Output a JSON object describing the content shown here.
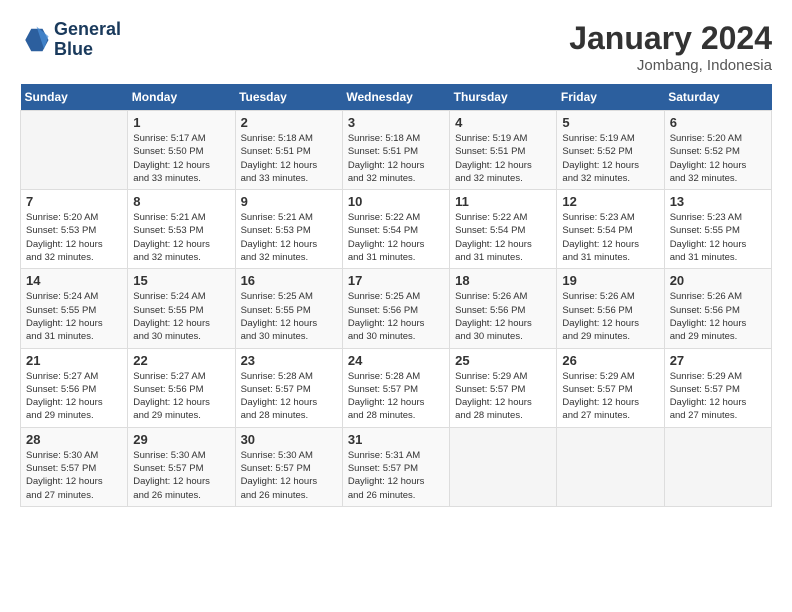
{
  "header": {
    "logo_line1": "General",
    "logo_line2": "Blue",
    "month_title": "January 2024",
    "location": "Jombang, Indonesia"
  },
  "days_of_week": [
    "Sunday",
    "Monday",
    "Tuesday",
    "Wednesday",
    "Thursday",
    "Friday",
    "Saturday"
  ],
  "weeks": [
    [
      {
        "day": "",
        "info": ""
      },
      {
        "day": "1",
        "info": "Sunrise: 5:17 AM\nSunset: 5:50 PM\nDaylight: 12 hours\nand 33 minutes."
      },
      {
        "day": "2",
        "info": "Sunrise: 5:18 AM\nSunset: 5:51 PM\nDaylight: 12 hours\nand 33 minutes."
      },
      {
        "day": "3",
        "info": "Sunrise: 5:18 AM\nSunset: 5:51 PM\nDaylight: 12 hours\nand 32 minutes."
      },
      {
        "day": "4",
        "info": "Sunrise: 5:19 AM\nSunset: 5:51 PM\nDaylight: 12 hours\nand 32 minutes."
      },
      {
        "day": "5",
        "info": "Sunrise: 5:19 AM\nSunset: 5:52 PM\nDaylight: 12 hours\nand 32 minutes."
      },
      {
        "day": "6",
        "info": "Sunrise: 5:20 AM\nSunset: 5:52 PM\nDaylight: 12 hours\nand 32 minutes."
      }
    ],
    [
      {
        "day": "7",
        "info": "Sunrise: 5:20 AM\nSunset: 5:53 PM\nDaylight: 12 hours\nand 32 minutes."
      },
      {
        "day": "8",
        "info": "Sunrise: 5:21 AM\nSunset: 5:53 PM\nDaylight: 12 hours\nand 32 minutes."
      },
      {
        "day": "9",
        "info": "Sunrise: 5:21 AM\nSunset: 5:53 PM\nDaylight: 12 hours\nand 32 minutes."
      },
      {
        "day": "10",
        "info": "Sunrise: 5:22 AM\nSunset: 5:54 PM\nDaylight: 12 hours\nand 31 minutes."
      },
      {
        "day": "11",
        "info": "Sunrise: 5:22 AM\nSunset: 5:54 PM\nDaylight: 12 hours\nand 31 minutes."
      },
      {
        "day": "12",
        "info": "Sunrise: 5:23 AM\nSunset: 5:54 PM\nDaylight: 12 hours\nand 31 minutes."
      },
      {
        "day": "13",
        "info": "Sunrise: 5:23 AM\nSunset: 5:55 PM\nDaylight: 12 hours\nand 31 minutes."
      }
    ],
    [
      {
        "day": "14",
        "info": "Sunrise: 5:24 AM\nSunset: 5:55 PM\nDaylight: 12 hours\nand 31 minutes."
      },
      {
        "day": "15",
        "info": "Sunrise: 5:24 AM\nSunset: 5:55 PM\nDaylight: 12 hours\nand 30 minutes."
      },
      {
        "day": "16",
        "info": "Sunrise: 5:25 AM\nSunset: 5:55 PM\nDaylight: 12 hours\nand 30 minutes."
      },
      {
        "day": "17",
        "info": "Sunrise: 5:25 AM\nSunset: 5:56 PM\nDaylight: 12 hours\nand 30 minutes."
      },
      {
        "day": "18",
        "info": "Sunrise: 5:26 AM\nSunset: 5:56 PM\nDaylight: 12 hours\nand 30 minutes."
      },
      {
        "day": "19",
        "info": "Sunrise: 5:26 AM\nSunset: 5:56 PM\nDaylight: 12 hours\nand 29 minutes."
      },
      {
        "day": "20",
        "info": "Sunrise: 5:26 AM\nSunset: 5:56 PM\nDaylight: 12 hours\nand 29 minutes."
      }
    ],
    [
      {
        "day": "21",
        "info": "Sunrise: 5:27 AM\nSunset: 5:56 PM\nDaylight: 12 hours\nand 29 minutes."
      },
      {
        "day": "22",
        "info": "Sunrise: 5:27 AM\nSunset: 5:56 PM\nDaylight: 12 hours\nand 29 minutes."
      },
      {
        "day": "23",
        "info": "Sunrise: 5:28 AM\nSunset: 5:57 PM\nDaylight: 12 hours\nand 28 minutes."
      },
      {
        "day": "24",
        "info": "Sunrise: 5:28 AM\nSunset: 5:57 PM\nDaylight: 12 hours\nand 28 minutes."
      },
      {
        "day": "25",
        "info": "Sunrise: 5:29 AM\nSunset: 5:57 PM\nDaylight: 12 hours\nand 28 minutes."
      },
      {
        "day": "26",
        "info": "Sunrise: 5:29 AM\nSunset: 5:57 PM\nDaylight: 12 hours\nand 27 minutes."
      },
      {
        "day": "27",
        "info": "Sunrise: 5:29 AM\nSunset: 5:57 PM\nDaylight: 12 hours\nand 27 minutes."
      }
    ],
    [
      {
        "day": "28",
        "info": "Sunrise: 5:30 AM\nSunset: 5:57 PM\nDaylight: 12 hours\nand 27 minutes."
      },
      {
        "day": "29",
        "info": "Sunrise: 5:30 AM\nSunset: 5:57 PM\nDaylight: 12 hours\nand 26 minutes."
      },
      {
        "day": "30",
        "info": "Sunrise: 5:30 AM\nSunset: 5:57 PM\nDaylight: 12 hours\nand 26 minutes."
      },
      {
        "day": "31",
        "info": "Sunrise: 5:31 AM\nSunset: 5:57 PM\nDaylight: 12 hours\nand 26 minutes."
      },
      {
        "day": "",
        "info": ""
      },
      {
        "day": "",
        "info": ""
      },
      {
        "day": "",
        "info": ""
      }
    ]
  ]
}
